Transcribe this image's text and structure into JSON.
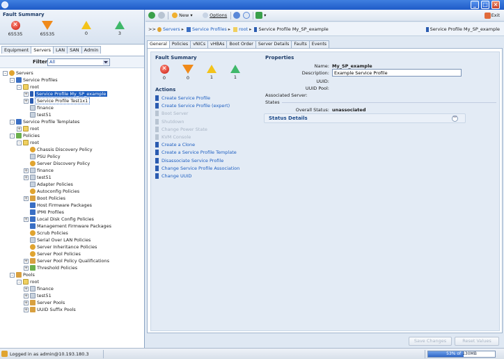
{
  "left": {
    "fault_summary": {
      "title": "Fault Summary",
      "counts": {
        "critical": "65535",
        "major": "65535",
        "minor": "0",
        "warning": "3"
      }
    },
    "nav_tabs": [
      "Equipment",
      "Servers",
      "LAN",
      "SAN",
      "Admin"
    ],
    "active_nav_tab": "Servers",
    "filter": {
      "label": "Filter:",
      "value": "All"
    },
    "tree": [
      {
        "label": "Servers",
        "expander": "-",
        "icon": "gear"
      },
      {
        "label": "Service Profiles",
        "expander": "-",
        "icon": "folder"
      },
      {
        "label": "root",
        "expander": "-",
        "icon": "root"
      },
      {
        "label": "Service Profile My_SP_example",
        "expander": "+",
        "icon": "sp",
        "selected": true
      },
      {
        "label": "Service Profile Test1x1",
        "expander": "+",
        "icon": "sp",
        "outlined": true
      },
      {
        "label": "finance",
        "expander": "",
        "icon": "plain"
      },
      {
        "label": "test51",
        "expander": "",
        "icon": "plain"
      },
      {
        "label": "Service Profile Templates",
        "expander": "-",
        "icon": "folder"
      },
      {
        "label": "root",
        "expander": "+",
        "icon": "root"
      },
      {
        "label": "Policies",
        "expander": "-",
        "icon": "policy"
      },
      {
        "label": "root",
        "expander": "-",
        "icon": "root"
      },
      {
        "label": "Chassis Discovery Policy",
        "expander": "",
        "icon": "gear"
      },
      {
        "label": "PSU Policy",
        "expander": "",
        "icon": "plain"
      },
      {
        "label": "Server Discovery Policy",
        "expander": "",
        "icon": "gear"
      },
      {
        "label": "finance",
        "expander": "+",
        "icon": "plain"
      },
      {
        "label": "test51",
        "expander": "+",
        "icon": "plain"
      },
      {
        "label": "Adapter Policies",
        "expander": "",
        "icon": "plain"
      },
      {
        "label": "Autoconfig Policies",
        "expander": "",
        "icon": "gear"
      },
      {
        "label": "Boot Policies",
        "expander": "+",
        "icon": "pool"
      },
      {
        "label": "Host Firmware Packages",
        "expander": "",
        "icon": "folder"
      },
      {
        "label": "IPMI Profiles",
        "expander": "",
        "icon": "folder"
      },
      {
        "label": "Local Disk Config Policies",
        "expander": "+",
        "icon": "folder"
      },
      {
        "label": "Management Firmware Packages",
        "expander": "",
        "icon": "folder"
      },
      {
        "label": "Scrub Policies",
        "expander": "",
        "icon": "gear"
      },
      {
        "label": "Serial Over LAN Policies",
        "expander": "",
        "icon": "plain"
      },
      {
        "label": "Server Inheritance Policies",
        "expander": "",
        "icon": "gear"
      },
      {
        "label": "Server Pool Policies",
        "expander": "",
        "icon": "gear"
      },
      {
        "label": "Server Pool Policy Qualifications",
        "expander": "+",
        "icon": "pool"
      },
      {
        "label": "Threshold Policies",
        "expander": "+",
        "icon": "policy"
      },
      {
        "label": "Pools",
        "expander": "-",
        "icon": "pool"
      },
      {
        "label": "root",
        "expander": "-",
        "icon": "root"
      },
      {
        "label": "finance",
        "expander": "+",
        "icon": "plain"
      },
      {
        "label": "test51",
        "expander": "+",
        "icon": "plain"
      },
      {
        "label": "Server Pools",
        "expander": "+",
        "icon": "pool"
      },
      {
        "label": "UUID Suffix Pools",
        "expander": "+",
        "icon": "pool"
      }
    ],
    "tree_indent": [
      0,
      1,
      2,
      3,
      3,
      3,
      3,
      1,
      2,
      1,
      2,
      3,
      3,
      3,
      3,
      3,
      3,
      3,
      3,
      3,
      3,
      3,
      3,
      3,
      3,
      3,
      3,
      3,
      3,
      1,
      2,
      3,
      3,
      3,
      3
    ]
  },
  "toolbar": {
    "new_label": "New",
    "options_label": "Options",
    "exit_label": "Exit"
  },
  "breadcrumb": {
    "prefix": ">>",
    "items": [
      "Servers",
      "Service Profiles",
      "root",
      "Service Profile My_SP_example"
    ],
    "right_label": "Service Profile My_SP_example"
  },
  "content_tabs": [
    "General",
    "Policies",
    "vNICs",
    "vHBAs",
    "Boot Order",
    "Server Details",
    "Faults",
    "Events"
  ],
  "active_content_tab": "General",
  "general": {
    "fault_summary": {
      "title": "Fault Summary",
      "counts": {
        "critical": "0",
        "major": "0",
        "minor": "1",
        "warning": "1"
      }
    },
    "actions_title": "Actions",
    "actions": [
      {
        "label": "Create Service Profile",
        "enabled": true
      },
      {
        "label": "Create Service Profile (expert)",
        "enabled": true
      },
      {
        "label": "Boot Server",
        "enabled": false
      },
      {
        "label": "Shutdown",
        "enabled": false
      },
      {
        "label": "Change Power State",
        "enabled": false
      },
      {
        "label": "KVM Console",
        "enabled": false
      },
      {
        "label": "Create a Clone",
        "enabled": true
      },
      {
        "label": "Create a Service Profile Template",
        "enabled": true
      },
      {
        "label": "Disassociate Service Profile",
        "enabled": true
      },
      {
        "label": "Change Service Profile Association",
        "enabled": true
      },
      {
        "label": "Change UUID",
        "enabled": true
      }
    ],
    "properties_title": "Properties",
    "properties": {
      "name_label": "Name:",
      "name_value": "My_SP_example",
      "description_label": "Description:",
      "description_value": "Example Service Profile",
      "uuid_label": "UUID:",
      "uuid_value": "",
      "uuid_pool_label": "UUID Pool:",
      "uuid_pool_value": "",
      "associated_server_label": "Associated Server:",
      "associated_server_value": "",
      "states_label": "States",
      "overall_status_label": "Overall Status:",
      "overall_status_value": "unassociated"
    },
    "status_details_label": "Status Details"
  },
  "buttons": {
    "save_changes": "Save Changes",
    "reset_values": "Reset Values"
  },
  "statusbar": {
    "login_text": "Logged in as admin@10.193.180.3",
    "memory_used": "53% of",
    "memory_total": "130MB",
    "memory_percent": 53
  },
  "colors": {
    "accent": "#1d5ec0",
    "titlebar": "#2a62d0",
    "critical": "#c8180c",
    "major": "#f08a1a",
    "minor": "#f3c31a",
    "warning": "#3fb86a"
  }
}
